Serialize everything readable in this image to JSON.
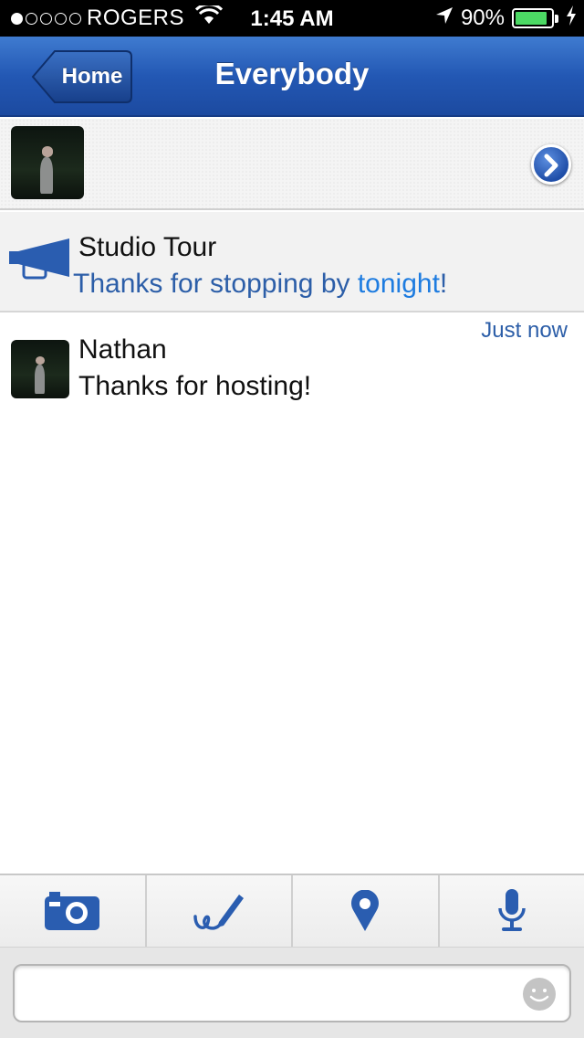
{
  "status_bar": {
    "carrier": "ROGERS",
    "time": "1:45 AM",
    "battery_percent": "90%",
    "battery_level": 0.9,
    "signal_bars": 1,
    "icons": [
      "wifi-icon",
      "location-arrow-icon",
      "battery-icon",
      "charging-bolt-icon"
    ]
  },
  "nav": {
    "back_label": "Home",
    "title": "Everybody"
  },
  "header": {
    "avatar": "avatar-photo",
    "chevron_icon": "chevron-right-icon"
  },
  "announcement": {
    "icon": "megaphone-icon",
    "title": "Studio Tour",
    "text_before": "Thanks for stopping by ",
    "link_text": "tonight",
    "text_after": "!"
  },
  "message": {
    "time": "Just now",
    "sender": "Nathan",
    "text": "Thanks for hosting!"
  },
  "toolbar": {
    "items": [
      {
        "icon": "camera-icon"
      },
      {
        "icon": "pen-icon"
      },
      {
        "icon": "location-pin-icon"
      },
      {
        "icon": "microphone-icon"
      }
    ]
  },
  "composer": {
    "value": "",
    "placeholder": "",
    "smiley_icon": "smiley-icon"
  },
  "colors": {
    "nav_blue": "#2358b4",
    "accent_blue": "#2c5ea8",
    "link_blue": "#1e7ce0",
    "battery_green": "#4cd964"
  }
}
